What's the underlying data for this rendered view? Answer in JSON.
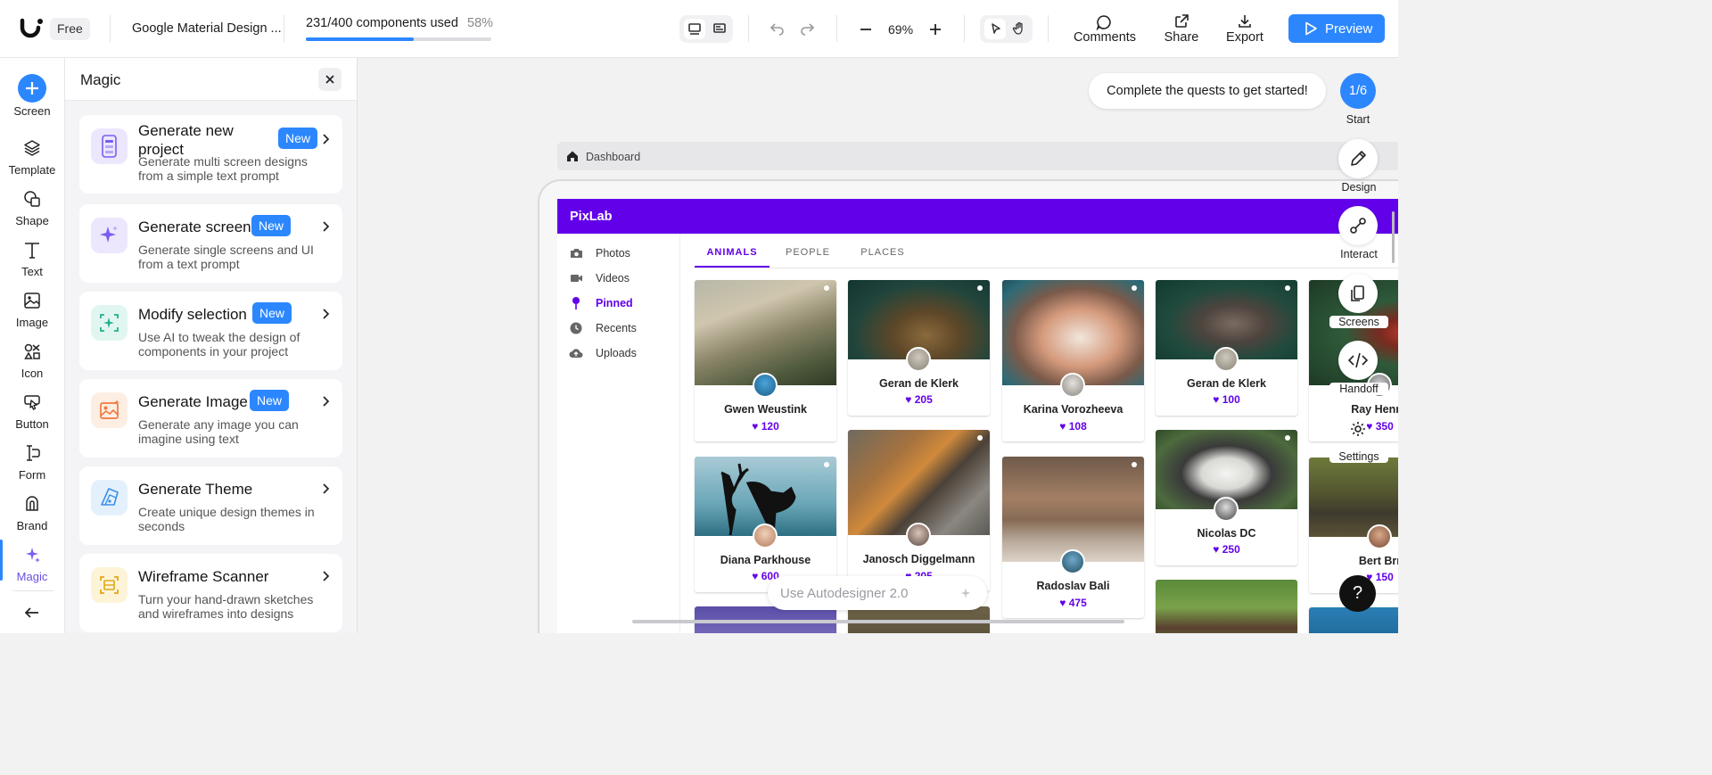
{
  "topbar": {
    "plan_badge": "Free",
    "project_name": "Google Material Design ...",
    "usage_text": "231/400 components used",
    "usage_percent_text": "58%",
    "usage_fraction": 0.58,
    "zoom": "69%",
    "comments_label": "Comments",
    "share_label": "Share",
    "export_label": "Export",
    "preview_label": "Preview"
  },
  "rail": {
    "items": [
      {
        "label": "Screen",
        "icon": "plus-icon"
      },
      {
        "label": "Template",
        "icon": "layers-icon"
      },
      {
        "label": "Shape",
        "icon": "shape-icon"
      },
      {
        "label": "Text",
        "icon": "text-icon"
      },
      {
        "label": "Image",
        "icon": "image-icon"
      },
      {
        "label": "Icon",
        "icon": "icon-grid-icon"
      },
      {
        "label": "Button",
        "icon": "pointer-icon"
      },
      {
        "label": "Form",
        "icon": "form-icon"
      },
      {
        "label": "Brand",
        "icon": "brand-icon"
      },
      {
        "label": "Magic",
        "icon": "sparkle-icon"
      }
    ]
  },
  "panel": {
    "title": "Magic",
    "new_badge": "New",
    "cards": [
      {
        "title": "Generate new project",
        "desc": "Generate multi screen designs from a simple text prompt",
        "new": true
      },
      {
        "title": "Generate screen",
        "desc": "Generate single screens and UI from a text prompt",
        "new": true
      },
      {
        "title": "Modify selection",
        "desc": "Use AI to tweak the design of components in your project",
        "new": true
      },
      {
        "title": "Generate Image",
        "desc": "Generate any image you can imagine using text",
        "new": true
      },
      {
        "title": "Generate Theme",
        "desc": "Create unique design themes in seconds",
        "new": false
      },
      {
        "title": "Wireframe Scanner",
        "desc": "Turn your hand-drawn sketches and wireframes into designs",
        "new": false
      }
    ]
  },
  "canvas": {
    "quest_text": "Complete the quests to get started!",
    "quest_progress": "1/6",
    "start_label": "Start",
    "breadcrumb": "Dashboard",
    "autodesigner_placeholder": "Use Autodesigner 2.0",
    "help_label": "?",
    "right_tools": [
      "Design",
      "Interact",
      "Screens",
      "Handoff",
      "Settings"
    ]
  },
  "app": {
    "brand": "PixLab",
    "nav": [
      "Photos",
      "Videos",
      "Pinned",
      "Recents",
      "Uploads"
    ],
    "tabs": [
      "ANIMALS",
      "PEOPLE",
      "PLACES"
    ],
    "photos": [
      {
        "name": "Gwen Weustink",
        "likes": "120"
      },
      {
        "name": "Geran de Klerk",
        "likes": "205"
      },
      {
        "name": "Karina Vorozheeva",
        "likes": "108"
      },
      {
        "name": "Geran de Klerk",
        "likes": "100"
      },
      {
        "name": "Ray Henne",
        "likes": "350"
      },
      {
        "name": "Diana Parkhouse",
        "likes": "600"
      },
      {
        "name": "Janosch Diggelmann",
        "likes": "205"
      },
      {
        "name": "Radoslav Bali",
        "likes": "475"
      },
      {
        "name": "Nicolas DC",
        "likes": "250"
      },
      {
        "name": "Bert Brr",
        "likes": "150"
      }
    ]
  },
  "colors": {
    "accent_blue": "#2c87ff",
    "app_purple": "#6200ea"
  }
}
